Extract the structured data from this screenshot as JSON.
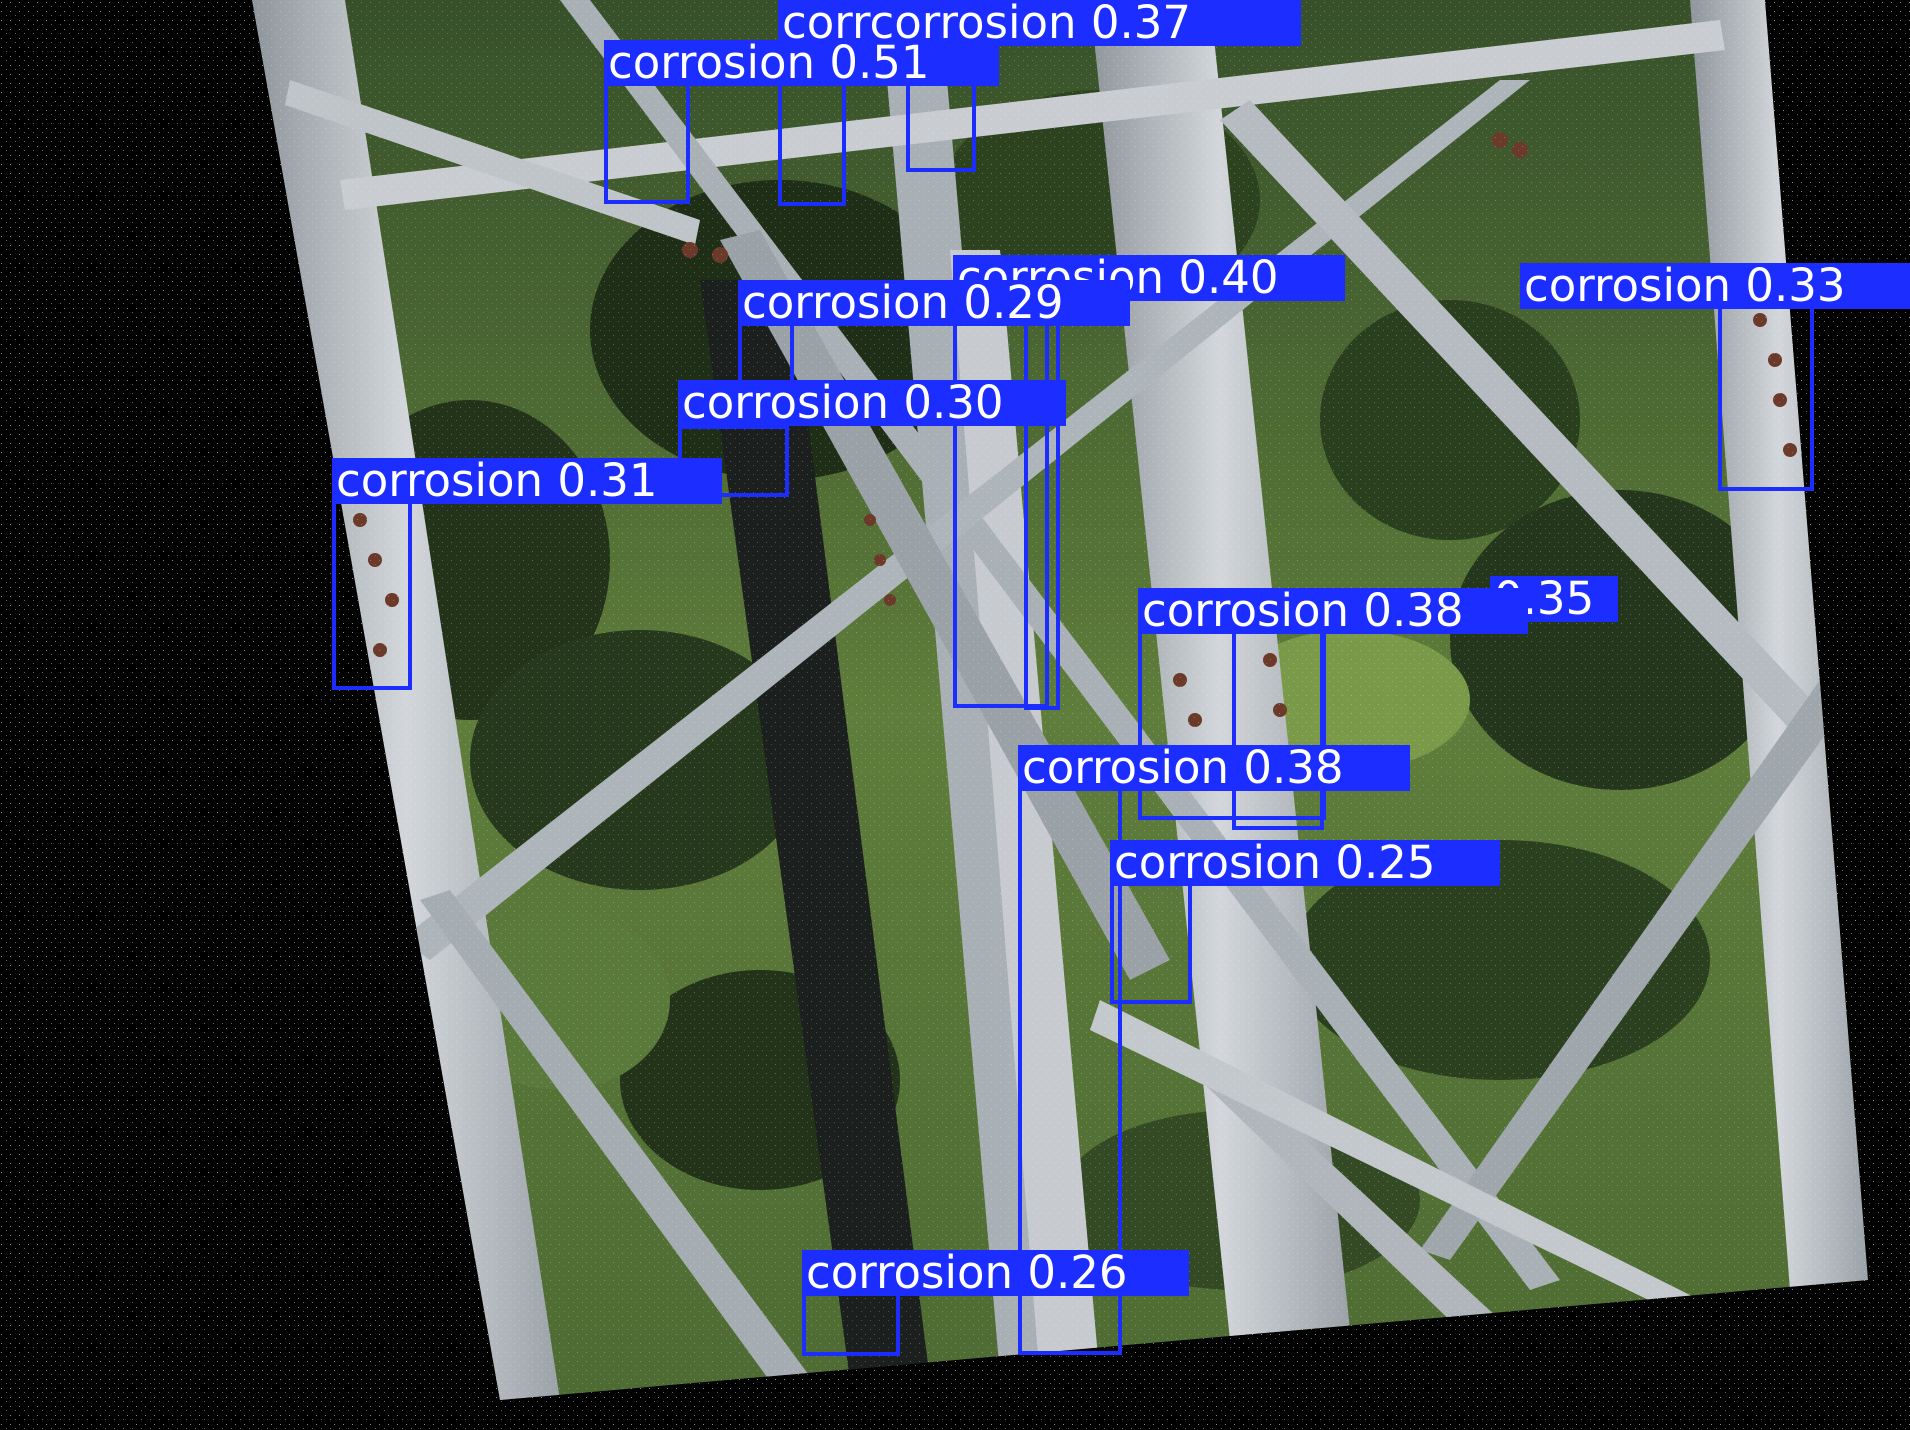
{
  "image": {
    "description_colors": {
      "background": "#000000",
      "box_color": "#1c2dff",
      "label_text": "#ffffff",
      "steel": "#b8bec4",
      "foliage": "#4f6a35",
      "dark_foliage": "#22331a",
      "rust": "#6b3a2a"
    }
  },
  "detections": [
    {
      "label": "corrosion",
      "score": "0.37",
      "text": "corrcorrosion 0.37"
    },
    {
      "label": "corrosion",
      "score": "0.51",
      "text": "corrosion 0.51"
    },
    {
      "label": "corrosion",
      "score": "0.40",
      "text": "corrosion 0.40"
    },
    {
      "label": "corrosion",
      "score": "0.29",
      "text": "corrosion 0.29"
    },
    {
      "label": "corrosion",
      "score": "0.33",
      "text": "corrosion 0.33"
    },
    {
      "label": "corrosion",
      "score": "0.30",
      "text": "corrosion 0.30"
    },
    {
      "label": "corrosion",
      "score": "0.31",
      "text": "corrosion 0.31"
    },
    {
      "label": "corrosion",
      "score": "0.35",
      "text": "0.35"
    },
    {
      "label": "corrosion",
      "score": "0.38",
      "text": "corrosion 0.38"
    },
    {
      "label": "corrosion",
      "score": "0.38",
      "text": "corrosion 0.38"
    },
    {
      "label": "corrosion",
      "score": "0.25",
      "text": "corrosion 0.25"
    },
    {
      "label": "corrosion",
      "score": "0.26",
      "text": "corrosion 0.26"
    }
  ]
}
